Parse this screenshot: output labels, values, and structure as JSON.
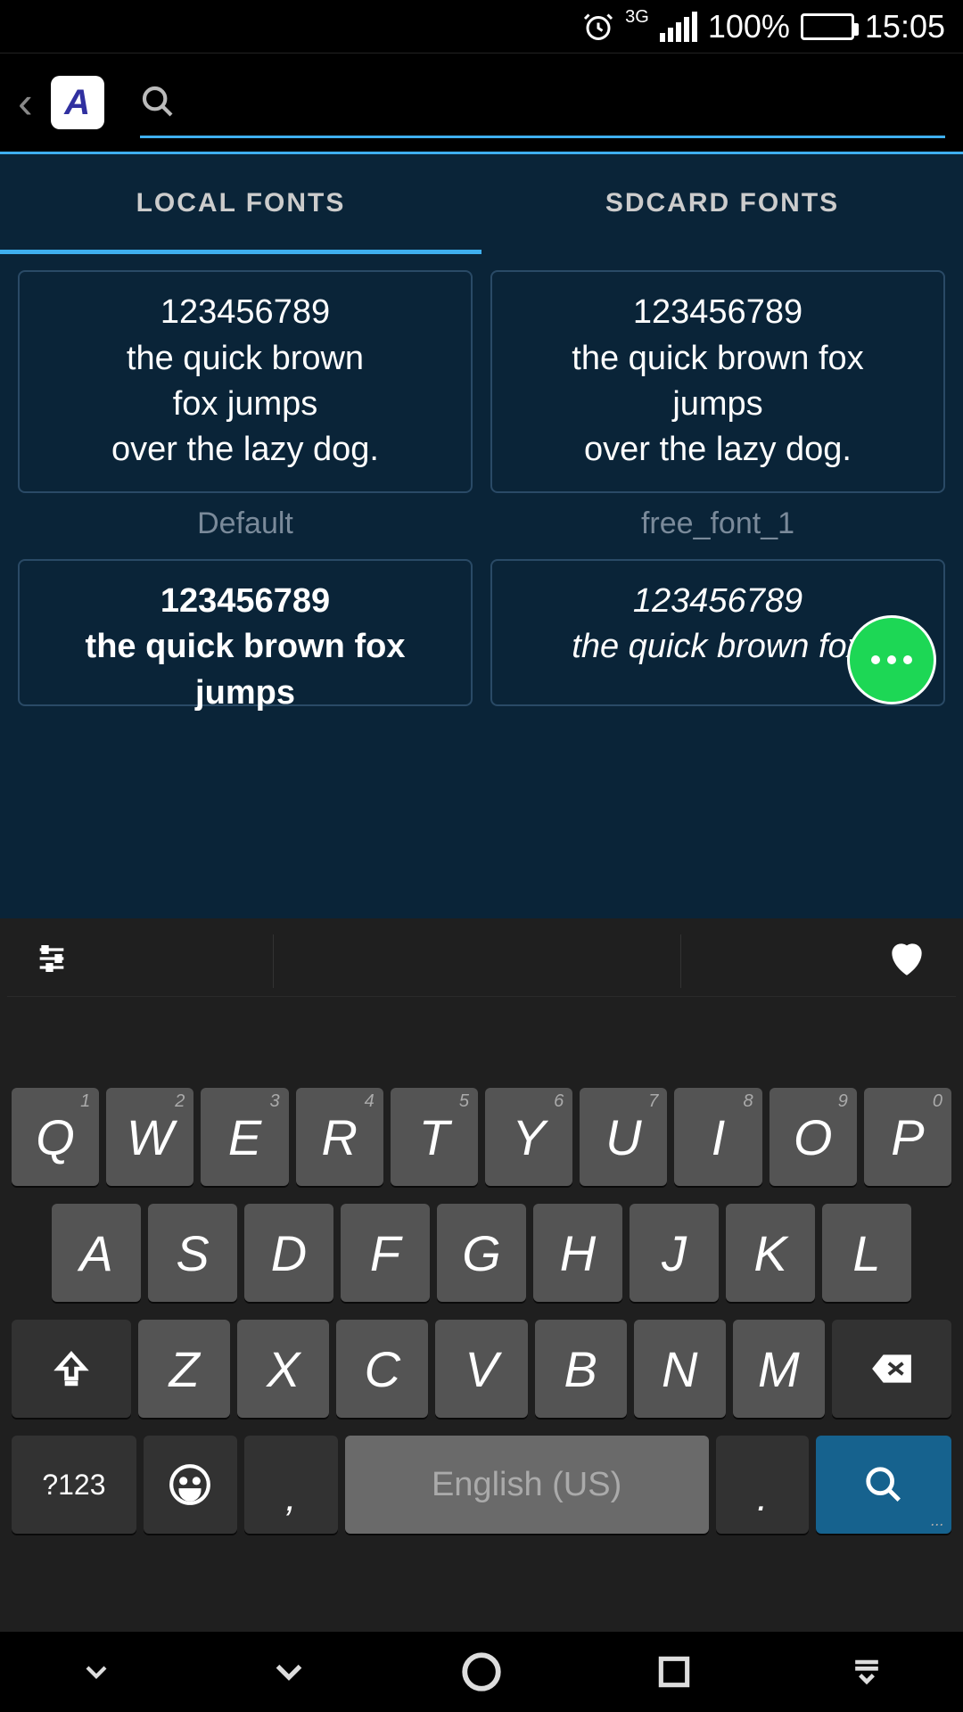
{
  "status": {
    "alarm": "⏰",
    "network": "3G",
    "battery_pct": "100%",
    "time": "15:05"
  },
  "header": {
    "back": "‹"
  },
  "tabs": {
    "local": "LOCAL FONTS",
    "sdcard": "SDCARD FONTS"
  },
  "sample": {
    "line1": "123456789",
    "line2": "the quick brown",
    "line3": "fox jumps",
    "line4": "over the lazy dog.",
    "line2b": "the quick brown fox",
    "line3b": "jumps"
  },
  "fonts": {
    "f1_label": "Default",
    "f2_label": "free_font_1"
  },
  "keyboard": {
    "row1": [
      "Q",
      "W",
      "E",
      "R",
      "T",
      "Y",
      "U",
      "I",
      "O",
      "P"
    ],
    "hints1": [
      "1",
      "2",
      "3",
      "4",
      "5",
      "6",
      "7",
      "8",
      "9",
      "0"
    ],
    "row2": [
      "A",
      "S",
      "D",
      "F",
      "G",
      "H",
      "J",
      "K",
      "L"
    ],
    "row3": [
      "Z",
      "X",
      "C",
      "V",
      "B",
      "N",
      "M"
    ],
    "sym": "?123",
    "comma": ",",
    "space": "English (US)",
    "period": "."
  }
}
